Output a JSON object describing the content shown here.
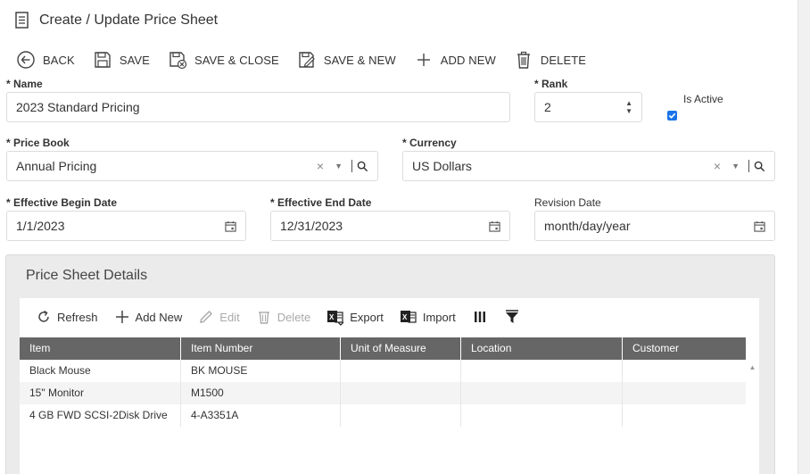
{
  "page": {
    "title": "Create / Update Price Sheet"
  },
  "toolbar": {
    "back": "BACK",
    "save": "SAVE",
    "save_close": "SAVE & CLOSE",
    "save_new": "SAVE & NEW",
    "add_new": "ADD NEW",
    "delete": "DELETE"
  },
  "form": {
    "name": {
      "label": "Name",
      "required_mark": "*",
      "value": "2023 Standard Pricing"
    },
    "rank": {
      "label": "Rank",
      "required_mark": "*",
      "value": "2"
    },
    "is_active": {
      "label": "Is Active",
      "checked": true
    },
    "price_book": {
      "label": "Price Book",
      "required_mark": "*",
      "value": "Annual Pricing"
    },
    "currency": {
      "label": "Currency",
      "required_mark": "*",
      "value": "US Dollars"
    },
    "effective_begin_date": {
      "label": "Effective Begin Date",
      "required_mark": "*",
      "value": "1/1/2023"
    },
    "effective_end_date": {
      "label": "Effective End Date",
      "required_mark": "*",
      "value": "12/31/2023"
    },
    "revision_date": {
      "label": "Revision Date",
      "value": "month/day/year"
    }
  },
  "details": {
    "title": "Price Sheet Details",
    "toolbar": {
      "refresh": "Refresh",
      "add_new": "Add New",
      "edit": "Edit",
      "delete": "Delete",
      "export": "Export",
      "import": "Import"
    },
    "columns": [
      "Item",
      "Item Number",
      "Unit of Measure",
      "Location",
      "Customer"
    ],
    "rows": [
      [
        "Black Mouse",
        "BK MOUSE",
        "",
        "",
        ""
      ],
      [
        "15\" Monitor",
        "M1500",
        "",
        "",
        ""
      ],
      [
        "4 GB FWD SCSI-2Disk Drive",
        "4-A3351A",
        "",
        "",
        ""
      ]
    ]
  },
  "colors": {
    "accent": "#1a73e8",
    "grid_header": "#666666",
    "panel_bg": "#ebebeb"
  }
}
